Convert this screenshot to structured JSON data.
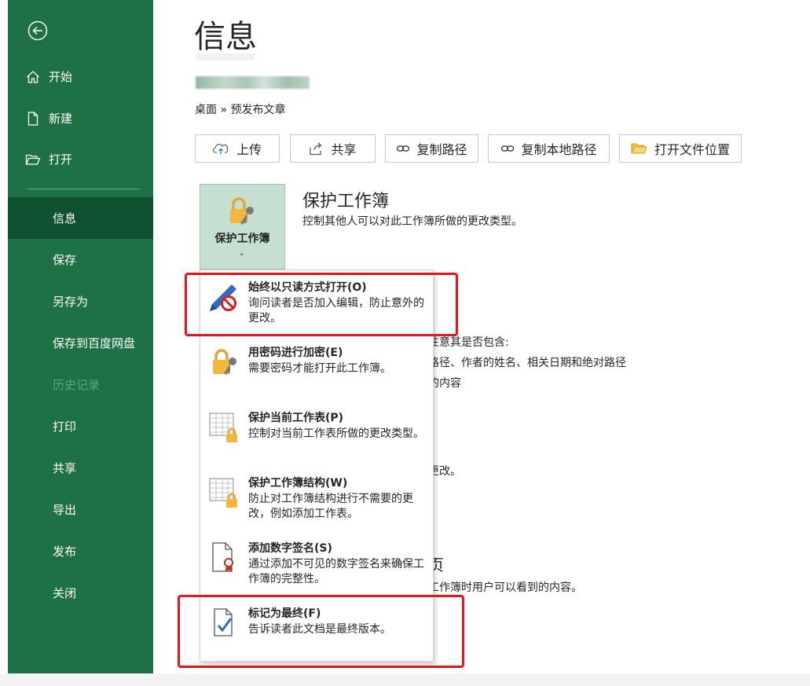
{
  "sidebar": {
    "items": [
      {
        "label": "开始"
      },
      {
        "label": "新建"
      },
      {
        "label": "打开"
      },
      {
        "label": "信息"
      },
      {
        "label": "保存"
      },
      {
        "label": "另存为"
      },
      {
        "label": "保存到百度网盘"
      },
      {
        "label": "历史记录"
      },
      {
        "label": "打印"
      },
      {
        "label": "共享"
      },
      {
        "label": "导出"
      },
      {
        "label": "发布"
      },
      {
        "label": "关闭"
      }
    ]
  },
  "main": {
    "title": "信息",
    "breadcrumb": "桌面 » 预发布文章",
    "actions": [
      {
        "label": "上传"
      },
      {
        "label": "共享"
      },
      {
        "label": "复制路径"
      },
      {
        "label": "复制本地路径"
      },
      {
        "label": "打开文件位置"
      }
    ],
    "protect": {
      "button_label": "保护工作簿",
      "chevron": "⌄",
      "title": "保护工作簿",
      "description": "控制其他人可以对此工作簿所做的更改类型。"
    },
    "background": {
      "line1": "注意其是否包含:",
      "line2": "路径、作者的姓名、相关日期和绝对路径",
      "line3": "的内容",
      "line4": "更改。",
      "heading": "页",
      "line5": "工作簿时用户可以看到的内容。"
    }
  },
  "dropdown": {
    "items": [
      {
        "title": "始终以只读方式打开(O)",
        "description": "询问读者是否加入编辑，防止意外的更改。"
      },
      {
        "title": "用密码进行加密(E)",
        "description": "需要密码才能打开此工作簿。"
      },
      {
        "title": "保护当前工作表(P)",
        "description": "控制对当前工作表所做的更改类型。"
      },
      {
        "title": "保护工作簿结构(W)",
        "description": "防止对工作簿结构进行不需要的更改，例如添加工作表。"
      },
      {
        "title": "添加数字签名(S)",
        "description": "通过添加不可见的数字签名来确保工作簿的完整性。"
      },
      {
        "title": "标记为最终(F)",
        "description": "告诉读者此文档是最终版本。"
      }
    ]
  },
  "colors": {
    "sidebar_bg": "#1e7145",
    "sidebar_active": "#0f5130",
    "highlight_red": "#e8141b",
    "tile_bg": "#c5e0d0"
  }
}
